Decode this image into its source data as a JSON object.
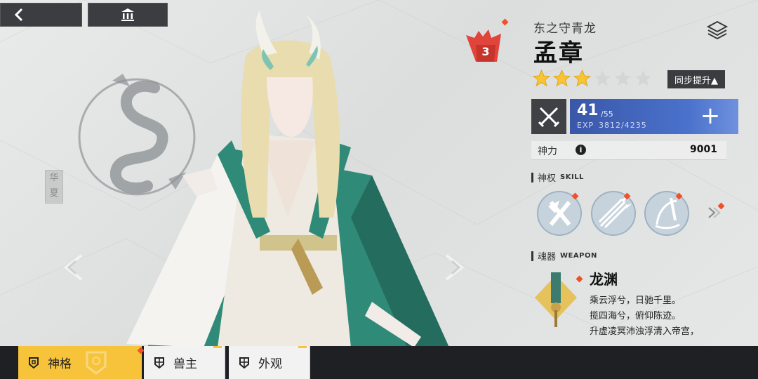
{
  "header": {
    "back_icon": "chevron-left-icon",
    "museum_icon": "museum-icon"
  },
  "background": {
    "emblem_icon": "dragon-emblem-icon",
    "side_text": "华夏"
  },
  "character": {
    "title": "东之守青龙",
    "name": "孟章",
    "rank": "3",
    "stars_filled": 3,
    "stars_total": 6,
    "sync_button": "同步提升▲",
    "level": "41",
    "level_max": "/55",
    "exp_label": "EXP",
    "exp_value": "3812/4235",
    "power_label": "神力",
    "power_value": "9001"
  },
  "skills": {
    "label_cn": "神权",
    "label_en": "SKILL",
    "items": [
      {
        "icon": "crossed-slash-skill-icon"
      },
      {
        "icon": "arrow-volley-skill-icon"
      },
      {
        "icon": "spear-wave-skill-icon"
      }
    ]
  },
  "weapon": {
    "label_cn": "魂器",
    "label_en": "WEAPON",
    "name": "龙渊",
    "lines": [
      "乘云浮兮，日驰千里。",
      "揽四海兮，俯仰陈迹。",
      "升虚凌冥沛浊浮清入帝宫，"
    ]
  },
  "tabs": [
    {
      "label": "神格",
      "icon": "divinity-icon",
      "active": true
    },
    {
      "label": "兽主",
      "icon": "shield-icon",
      "active": false
    },
    {
      "label": "外观",
      "icon": "shield-icon",
      "active": false
    }
  ],
  "colors": {
    "accent_yellow": "#f6c33a",
    "level_blue": "#4a72cc",
    "notify_red": "#f0502a",
    "dark_panel": "#3b3d40",
    "robe_green": "#2f8a77"
  }
}
